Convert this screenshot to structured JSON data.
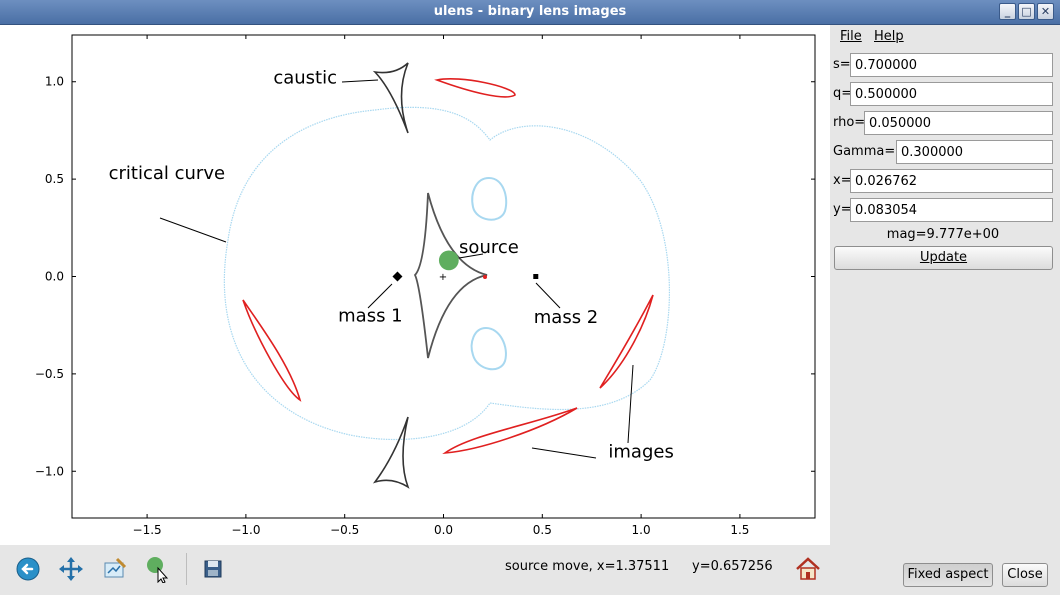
{
  "window": {
    "title": "ulens - binary lens images",
    "buttons": [
      "_",
      "□",
      "✕"
    ]
  },
  "toolbar": {
    "icons": [
      "back-icon",
      "pan-icon",
      "configure-icon",
      "source-move-icon",
      "save-icon",
      "home-icon"
    ],
    "status_mode": "source move, x=1.37511",
    "status_y": "y=0.657256"
  },
  "menu": {
    "file": "File",
    "help": "Help"
  },
  "params": {
    "s_label": "s=",
    "s_value": "0.700000",
    "q_label": "q=",
    "q_value": "0.500000",
    "rho_label": "rho=",
    "rho_value": "0.050000",
    "gamma_label": "Gamma=",
    "gamma_value": "0.300000",
    "x_label": "x=",
    "x_value": "0.026762",
    "y_label": "y=",
    "y_value": "0.083054"
  },
  "mag": "mag=9.777e+00",
  "buttons": {
    "update": "Update",
    "fixed_aspect": "Fixed aspect",
    "close": "Close"
  },
  "chart_data": {
    "type": "scatter",
    "xlim": [
      -1.88,
      1.88
    ],
    "ylim": [
      -1.24,
      1.24
    ],
    "xticks": [
      -1.5,
      -1.0,
      -0.5,
      0.0,
      0.5,
      1.0,
      1.5
    ],
    "xtick_labels": [
      "−1.5",
      "−1.0",
      "−0.5",
      "0.0",
      "0.5",
      "1.0",
      "1.5"
    ],
    "yticks": [
      -1.0,
      -0.5,
      0.0,
      0.5,
      1.0
    ],
    "ytick_labels": [
      "−1.0",
      "−0.5",
      "0.0",
      "0.5",
      "1.0"
    ],
    "colors": {
      "critical": "#a8d8f0",
      "images": "#e02020",
      "source": "#5fae5f",
      "caustic": "#222222"
    },
    "masses": [
      {
        "x": -0.233,
        "y": 0.0
      },
      {
        "x": 0.467,
        "y": 0.0
      }
    ],
    "source": {
      "x": 0.027,
      "y": 0.083,
      "rho": 0.05
    },
    "annotations": [
      {
        "text": "caustic",
        "x": -0.7,
        "y": 0.99
      },
      {
        "text": "critical curve",
        "x": -1.4,
        "y": 0.5
      },
      {
        "text": "source",
        "x": 0.23,
        "y": 0.12
      },
      {
        "text": "mass 1",
        "x": -0.37,
        "y": -0.23
      },
      {
        "text": "mass 2",
        "x": 0.62,
        "y": -0.24
      },
      {
        "text": "images",
        "x": 1.0,
        "y": -0.93
      }
    ]
  }
}
